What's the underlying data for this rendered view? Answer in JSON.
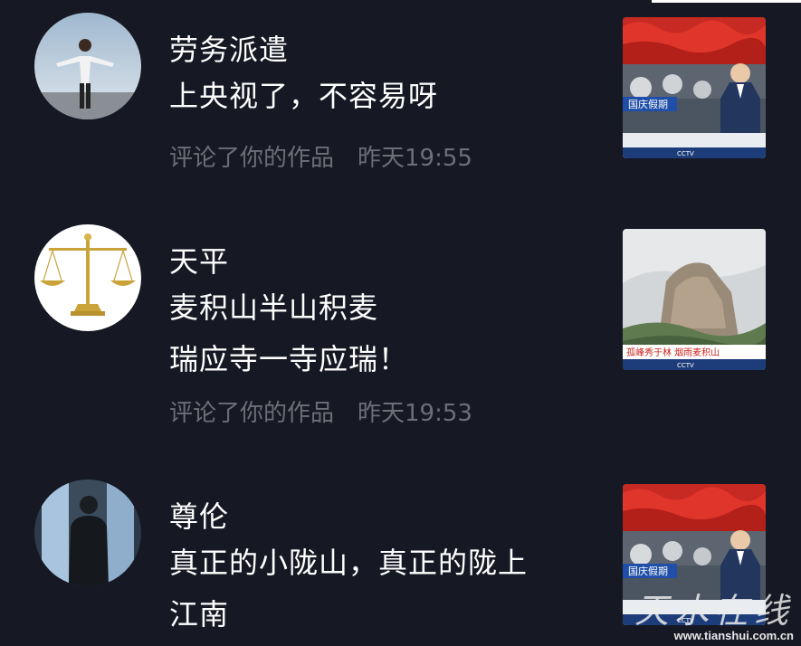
{
  "notifications": [
    {
      "username": "劳务派遣",
      "comment_lines": [
        "上央视了，不容易呀"
      ],
      "action": "评论了你的作品",
      "time": "昨天19:55",
      "thumbnail": {
        "kind": "news-anchor",
        "banner": "国庆假期",
        "ticker": "CCTV"
      }
    },
    {
      "username": "天平",
      "comment_lines": [
        "麦积山半山积麦",
        "瑞应寺一寺应瑞！"
      ],
      "action": "评论了你的作品",
      "time": "昨天19:53",
      "thumbnail": {
        "kind": "mountain",
        "banner": "孤峰秀于林  烟雨麦积山",
        "ticker": "CCTV"
      }
    },
    {
      "username": "尊伦",
      "comment_lines": [
        "真正的小陇山，真正的陇上",
        "江南"
      ],
      "action": "",
      "time": "",
      "thumbnail": {
        "kind": "news-anchor",
        "banner": "国庆假期",
        "ticker": "CCTV"
      }
    }
  ],
  "watermark": {
    "brand": "天水在线",
    "url": "www.tianshui.com.cn"
  },
  "colors": {
    "background": "#161823",
    "primary_text": "#ffffff",
    "secondary_text": "#6d6e78"
  }
}
